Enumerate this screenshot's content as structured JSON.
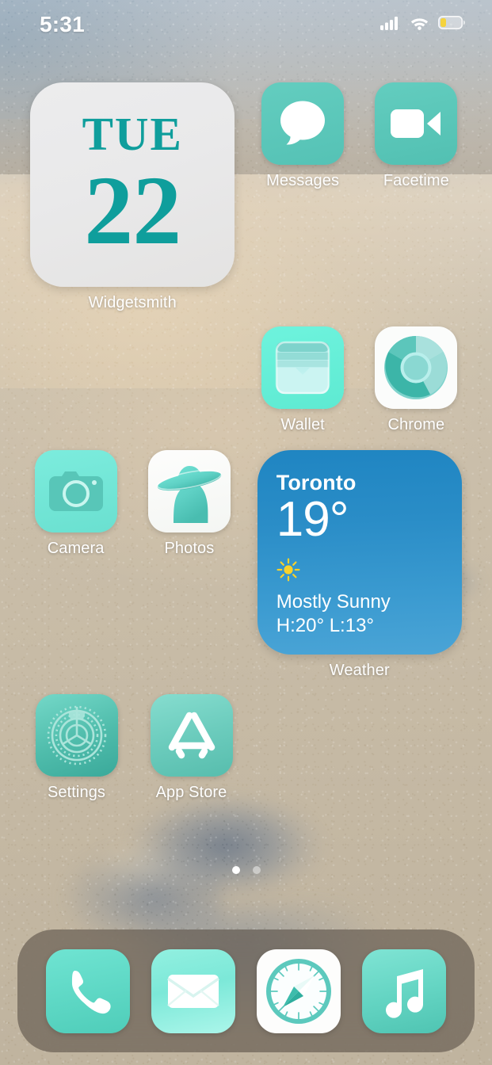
{
  "status_bar": {
    "time": "5:31",
    "cellular_icon": "cellular-signal-icon",
    "cellular_bars_filled": 4,
    "wifi_icon": "wifi-icon",
    "battery_icon": "battery-icon",
    "battery_level_percent": 25,
    "battery_color": "#f5d33d",
    "low_power_mode": true
  },
  "theme": {
    "accent_teal": "#0f9e9c",
    "icon_teal": "#5fc9bd",
    "icon_mint": "#6ff0dc",
    "weather_blue": "#2a8dc7",
    "label_color": "#ffffff"
  },
  "home_screen": {
    "rows": [
      {
        "widget": {
          "name": "widgetsmith-date-widget",
          "label": "Widgetsmith",
          "day_of_week": "TUE",
          "day_number": "22"
        },
        "apps": [
          {
            "name": "messages",
            "label": "Messages",
            "icon": "message-bubble-icon"
          },
          {
            "name": "facetime",
            "label": "Facetime",
            "icon": "video-camera-icon"
          }
        ]
      },
      {
        "apps": [
          {
            "name": "wallet",
            "label": "Wallet",
            "icon": "wallet-cards-icon"
          },
          {
            "name": "chrome",
            "label": "Chrome",
            "icon": "chrome-circle-icon"
          }
        ]
      },
      {
        "apps": [
          {
            "name": "camera",
            "label": "Camera",
            "icon": "camera-icon"
          },
          {
            "name": "photos",
            "label": "Photos",
            "icon": "photos-silhouette-icon"
          }
        ],
        "widget": {
          "name": "weather-widget",
          "label": "Weather",
          "city": "Toronto",
          "temperature": "19°",
          "condition_icon": "sun-icon",
          "condition": "Mostly Sunny",
          "high_low": "H:20° L:13°"
        }
      },
      {
        "apps": [
          {
            "name": "settings",
            "label": "Settings",
            "icon": "gear-icon"
          },
          {
            "name": "app-store",
            "label": "App Store",
            "icon": "app-store-a-icon"
          }
        ]
      }
    ],
    "page_dots": {
      "total": 2,
      "active_index": 0
    },
    "dock": [
      {
        "name": "phone",
        "label": "Phone",
        "icon": "phone-handset-icon"
      },
      {
        "name": "mail",
        "label": "Mail",
        "icon": "envelope-icon"
      },
      {
        "name": "safari",
        "label": "Safari",
        "icon": "compass-icon"
      },
      {
        "name": "music",
        "label": "Music",
        "icon": "music-note-icon"
      }
    ]
  }
}
